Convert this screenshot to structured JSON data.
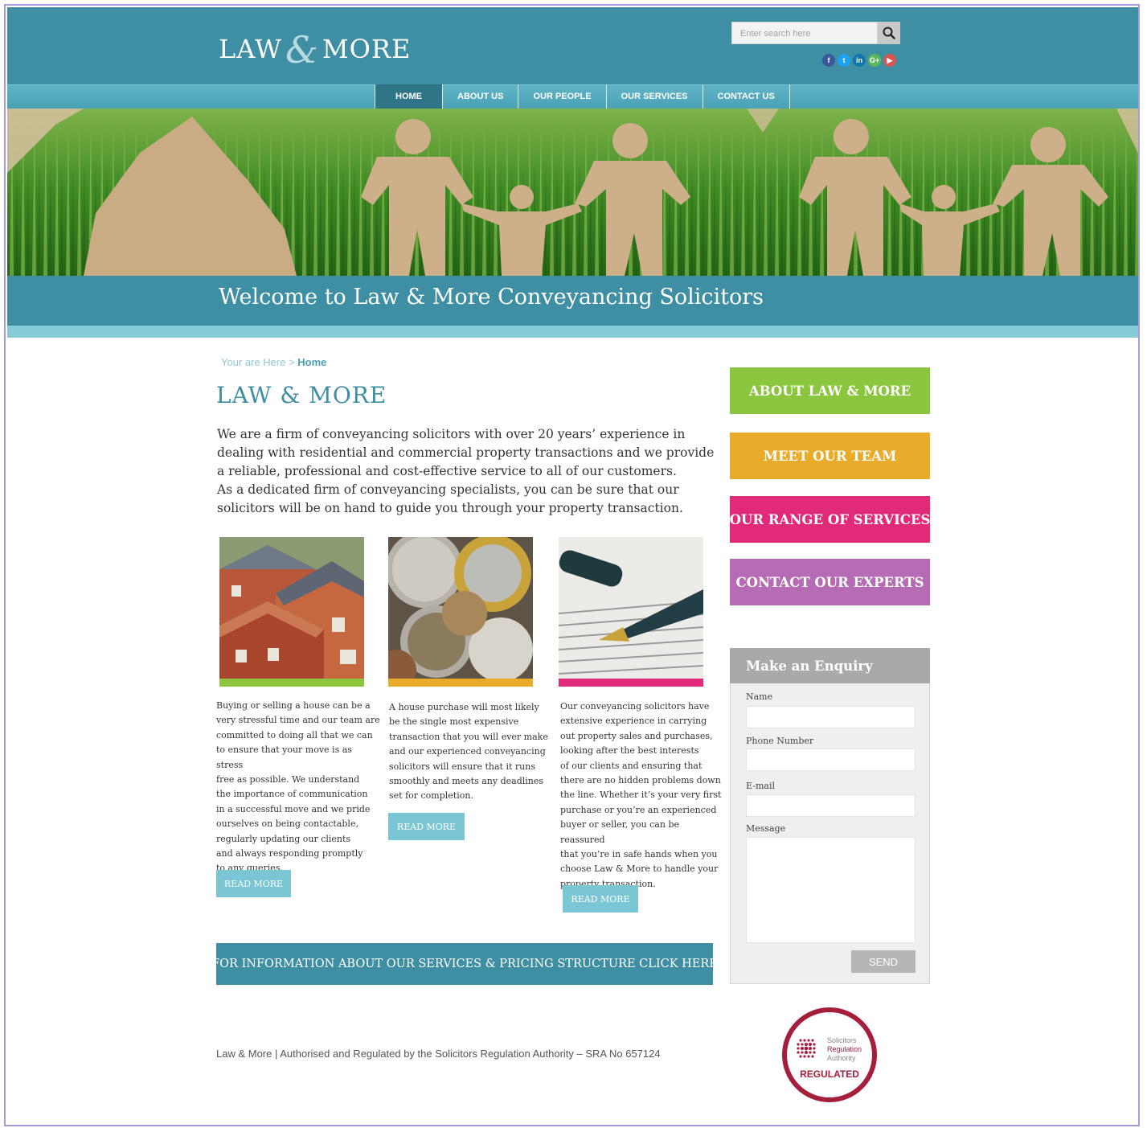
{
  "header": {
    "logo_left": "LAW",
    "logo_amp": "&",
    "logo_right": "MORE",
    "search_placeholder": "Enter search here",
    "socials": [
      {
        "name": "facebook-icon",
        "glyph": "f",
        "color": "#3b5998"
      },
      {
        "name": "twitter-icon",
        "glyph": "t",
        "color": "#1da1f2"
      },
      {
        "name": "linkedin-icon",
        "glyph": "in",
        "color": "#0e76a8"
      },
      {
        "name": "googleplus-icon",
        "glyph": "G+",
        "color": "#5cb85c"
      },
      {
        "name": "youtube-icon",
        "glyph": "▶",
        "color": "#d9534f"
      }
    ]
  },
  "nav": {
    "items": [
      "HOME",
      "ABOUT US",
      "OUR PEOPLE",
      "OUR SERVICES",
      "CONTACT US"
    ],
    "active": "HOME"
  },
  "banner": {
    "title": "Welcome to Law & More Conveyancing Solicitors"
  },
  "breadcrumb": {
    "prefix": "Your are Here > ",
    "current": "Home"
  },
  "main": {
    "heading": "LAW & MORE",
    "intro": [
      "We are a firm of conveyancing solicitors with over 20 years’ experience in",
      "dealing with residential and commercial property transactions and we provide",
      "a reliable, professional and cost-effective service to all of our customers.",
      "As a dedicated firm of conveyancing specialists, you can be sure that our",
      "solicitors will be on hand to guide you through your property transaction."
    ],
    "cards": [
      {
        "image": "houses-rooftops-image",
        "stripe_color": "#8cc63f",
        "lines": [
          "Buying or selling a house can be a",
          "very stressful time and our team are",
          "committed to doing all that we can",
          "to ensure that your move is as stress",
          "free as possible. We understand",
          "the importance of communication",
          "in a successful move and we pride",
          "ourselves on being contactable,",
          "regularly updating our clients",
          "and always responding promptly",
          "to any queries."
        ],
        "button": "READ MORE"
      },
      {
        "image": "coins-image",
        "stripe_color": "#e8ac2a",
        "lines": [
          "A house purchase will most likely",
          "be the single most expensive",
          "transaction that you will ever make",
          "and our experienced conveyancing",
          "solicitors will ensure that it runs",
          "smoothly and meets any deadlines",
          "set for completion."
        ],
        "button": "READ MORE"
      },
      {
        "image": "pen-document-image",
        "stripe_color": "#e22a7b",
        "lines": [
          "Our conveyancing solicitors have",
          "extensive experience in carrying",
          "out property sales and purchases,",
          "looking after the best interests",
          "of our clients and ensuring that",
          "there are no hidden problems down",
          "the line. Whether it’s your very first",
          "purchase or you’re an experienced",
          "buyer or seller, you can be reassured",
          "that you’re in safe hands when you",
          "choose Law & More to handle your",
          "property transaction."
        ],
        "button": "READ MORE"
      }
    ],
    "info_bar": "FOR INFORMATION ABOUT OUR SERVICES & PRICING STRUCTURE CLICK HERE"
  },
  "sidebar": {
    "buttons": [
      {
        "label": "ABOUT LAW & MORE",
        "color": "#8cc63f"
      },
      {
        "label": "MEET OUR TEAM",
        "color": "#e8ac2a"
      },
      {
        "label": "OUR RANGE OF SERVICES",
        "color": "#e22a7b"
      },
      {
        "label": "CONTACT OUR EXPERTS",
        "color": "#b56cb5"
      }
    ],
    "enquiry": {
      "title": "Make an Enquiry",
      "name_label": "Name",
      "phone_label": "Phone Number",
      "email_label": "E-mail",
      "message_label": "Message",
      "send_label": "SEND"
    }
  },
  "footer": {
    "text": "Law & More  | Authorised and Regulated by the Solicitors Regulation Authority – SRA No 657124",
    "badge_line1": "Solicitors",
    "badge_line2": "Regulation",
    "badge_line3": "Authority",
    "badge_regulated": "REGULATED"
  },
  "colors": {
    "teal": "#3e8fa3",
    "light_teal": "#86ccd6",
    "sra_red": "#a51f3c"
  }
}
